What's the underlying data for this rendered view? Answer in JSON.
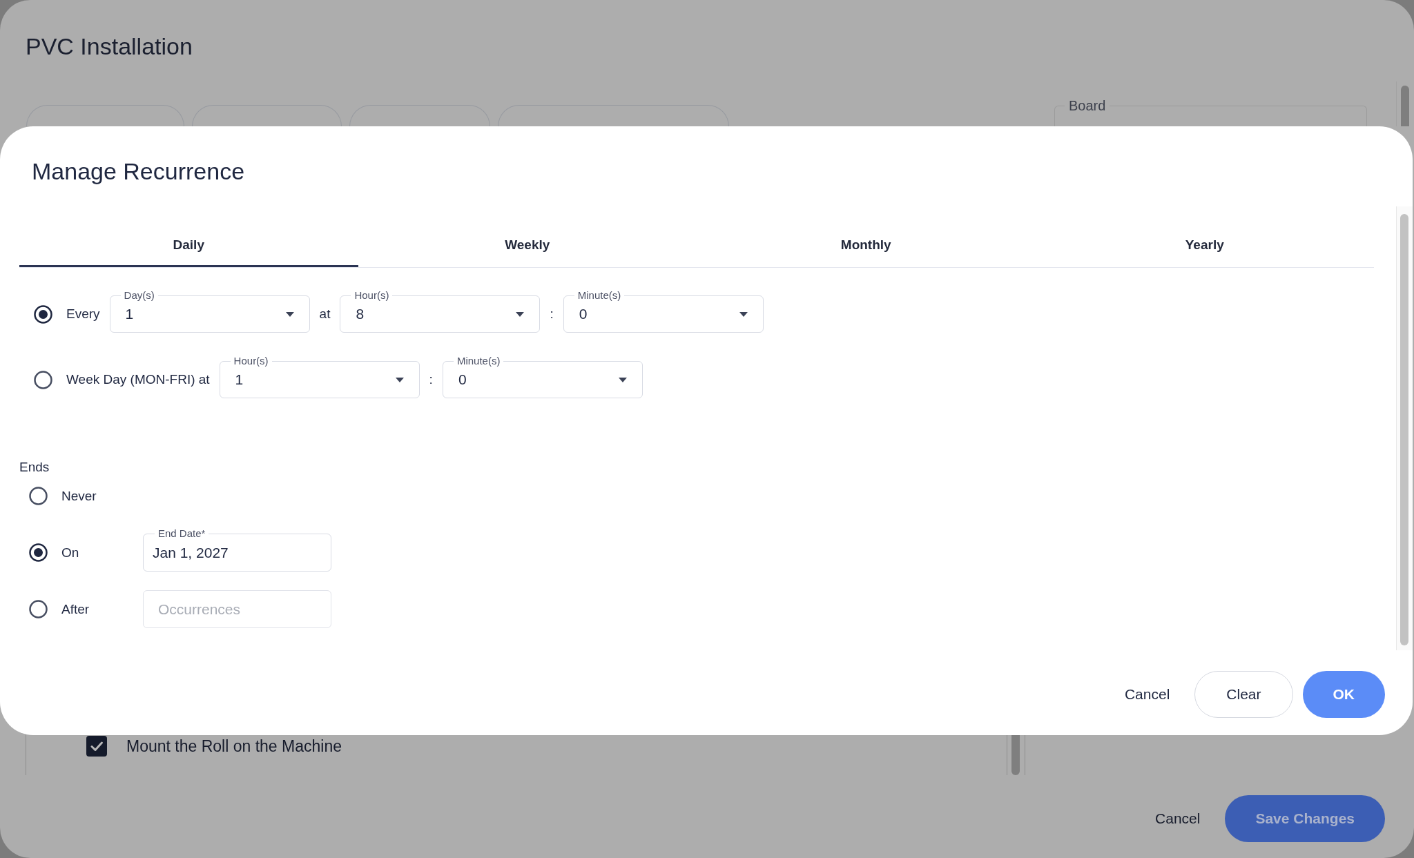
{
  "background_page": {
    "title": "PVC Installation",
    "board_field": {
      "label": "Board"
    },
    "checklist": [
      {
        "label": "Mount the Roll on the Machine",
        "checked": true
      }
    ],
    "footer_buttons": [
      {
        "label": "Cancel",
        "kind": "text"
      },
      {
        "label": "Save Changes",
        "kind": "primary"
      }
    ]
  },
  "dialog": {
    "title": "Manage Recurrence",
    "tabs": [
      {
        "label": "Daily",
        "selected": true
      },
      {
        "label": "Weekly",
        "selected": false
      },
      {
        "label": "Monthly",
        "selected": false
      },
      {
        "label": "Yearly",
        "selected": false
      }
    ],
    "options": [
      {
        "label": "Every",
        "selected": true,
        "parts": [
          {
            "kind": "select",
            "label": "Day(s)",
            "value": "1"
          },
          {
            "kind": "text",
            "text": "at"
          },
          {
            "kind": "select",
            "label": "Hour(s)",
            "value": "8"
          },
          {
            "kind": "text",
            "text": ":"
          },
          {
            "kind": "select",
            "label": "Minute(s)",
            "value": "0"
          }
        ]
      },
      {
        "label": "Week Day (MON-FRI) at",
        "selected": false,
        "parts": [
          {
            "kind": "select",
            "label": "Hour(s)",
            "value": "1"
          },
          {
            "kind": "text",
            "text": ":"
          },
          {
            "kind": "select",
            "label": "Minute(s)",
            "value": "0"
          }
        ]
      }
    ],
    "ends": {
      "label": "Ends",
      "options": [
        {
          "label": "Never",
          "selected": false
        },
        {
          "label": "On",
          "selected": true,
          "field": {
            "kind": "date",
            "label": "End Date*",
            "value": "Jan 1, 2027"
          }
        },
        {
          "label": "After",
          "selected": false,
          "field": {
            "kind": "input",
            "placeholder": "Occurrences"
          }
        }
      ]
    },
    "buttons": [
      {
        "label": "Cancel",
        "kind": "text"
      },
      {
        "label": "Clear",
        "kind": "outlined"
      },
      {
        "label": "OK",
        "kind": "primary"
      }
    ]
  }
}
